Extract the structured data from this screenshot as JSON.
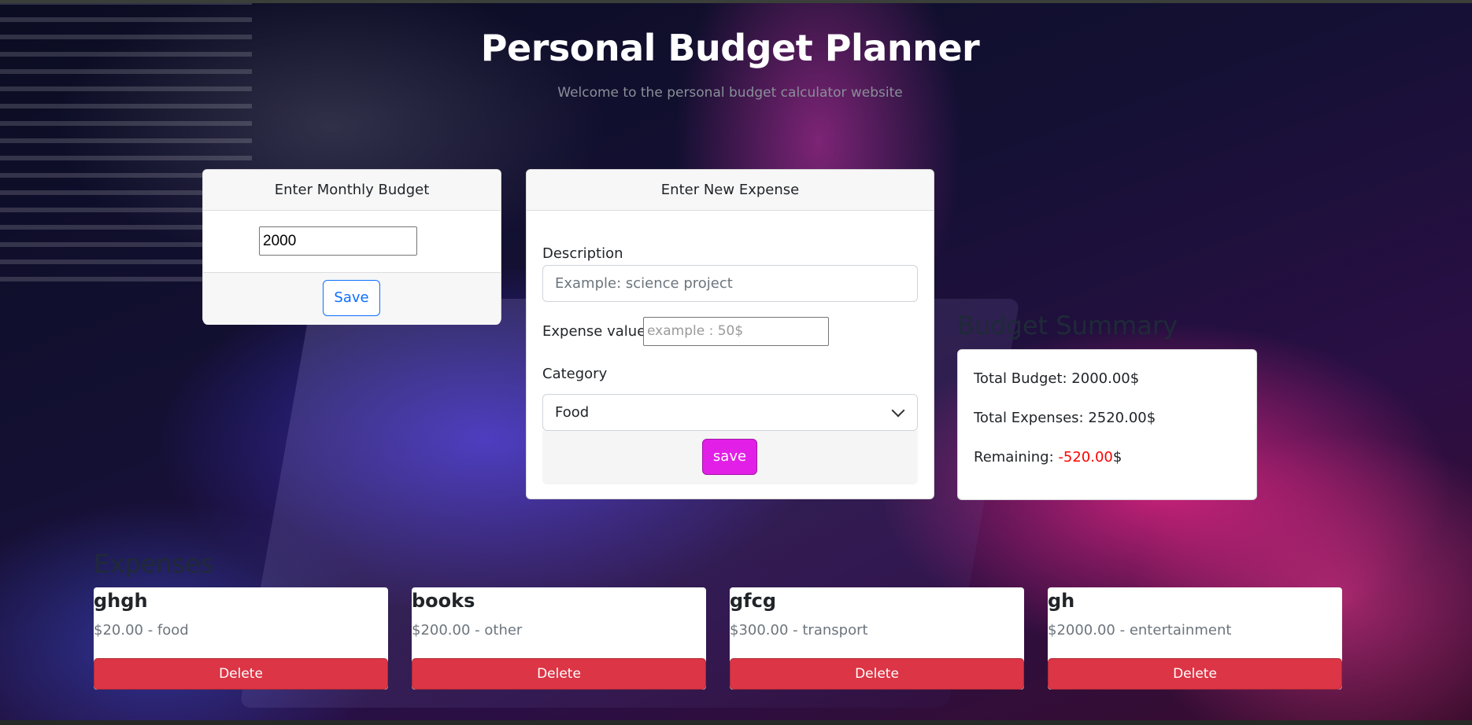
{
  "header": {
    "title": "Personal Budget Planner",
    "subtitle": "Welcome to the personal budget calculator website"
  },
  "budget_form": {
    "header": "Enter Monthly Budget",
    "input_value": "2000",
    "save_label": "Save"
  },
  "expense_form": {
    "header": "Enter New Expense",
    "description_label": "Description",
    "description_placeholder": "Example: science project",
    "value_label": "Expense value",
    "value_placeholder": "example : 50$",
    "category_label": "Category",
    "category_selected": "Food",
    "save_label": "save"
  },
  "summary": {
    "title": "Budget Summary",
    "total_budget_label": "Total Budget: ",
    "total_budget_value": "2000.00$",
    "total_expenses_label": "Total Expenses: ",
    "total_expenses_value": "2520.00$",
    "remaining_label": "Remaining: ",
    "remaining_value": "-520.00",
    "remaining_unit": "$",
    "negative_color": "#ff0000"
  },
  "expenses": {
    "title": "Expenses",
    "delete_label": "Delete",
    "items": [
      {
        "name": "ghgh",
        "detail": "$20.00 - food"
      },
      {
        "name": "books",
        "detail": "$200.00 - other"
      },
      {
        "name": "gfcg",
        "detail": "$300.00 - transport"
      },
      {
        "name": "gh",
        "detail": "$2000.00 - entertainment"
      }
    ]
  },
  "colors": {
    "accent_blue": "#0d6efd",
    "save_pink": "#e21fe6",
    "delete_red": "#dc3545"
  }
}
